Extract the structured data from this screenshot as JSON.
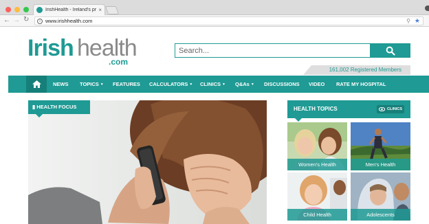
{
  "browser": {
    "tab_title": "IrishHealth - Ireland's premier",
    "tab_close": "×",
    "url": "www.irishhealth.com",
    "traffic_lights": [
      "#fc605c",
      "#fdbc40",
      "#34c84a"
    ]
  },
  "header": {
    "logo_irish": "Irish",
    "logo_health": "health",
    "logo_com": ".com",
    "search_placeholder": "Search...",
    "members": "161,002 Registered Members"
  },
  "nav": {
    "items": [
      {
        "label": "NEWS",
        "caret": false
      },
      {
        "label": "TOPICS",
        "caret": true
      },
      {
        "label": "FEATURES",
        "caret": false
      },
      {
        "label": "CALCULATORS",
        "caret": true
      },
      {
        "label": "CLINICS",
        "caret": true
      },
      {
        "label": "Q&As",
        "caret": true
      },
      {
        "label": "DISCUSSIONS",
        "caret": false
      },
      {
        "label": "VIDEO",
        "caret": false
      },
      {
        "label": "RATE MY HOSPITAL",
        "caret": false
      }
    ]
  },
  "main": {
    "focus_label": "HEALTH FOCUS"
  },
  "sidebar": {
    "title": "HEALTH TOPICS",
    "clinics_label": "CLINICS",
    "tiles": [
      {
        "label": "Women's Health"
      },
      {
        "label": "Men's Health"
      },
      {
        "label": "Child Health"
      },
      {
        "label": "Adolescents"
      }
    ]
  },
  "colors": {
    "brand": "#1f9a94",
    "brand_dark": "#177f79",
    "logo_grey": "#8a8a8a"
  }
}
